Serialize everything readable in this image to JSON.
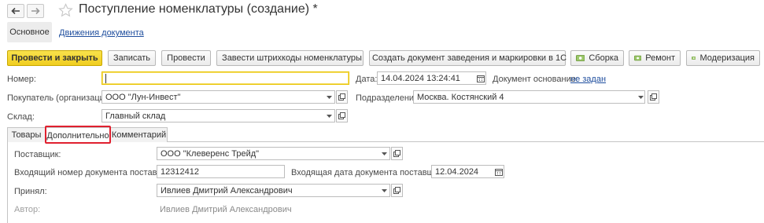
{
  "window": {
    "title": "Поступление номенклатуры (создание) *"
  },
  "top_tabs": {
    "main": "Основное",
    "movements": "Движения документа"
  },
  "toolbar": {
    "post_close": "Провести и закрыть",
    "save": "Записать",
    "post": "Провести",
    "barcodes": "Завести штрихкоды номенклатуры",
    "create_marking": "Создать документ заведения и маркировки в 1С",
    "assembly": "Сборка",
    "repair": "Ремонт",
    "modernization": "Модеризация"
  },
  "form": {
    "number_label": "Номер:",
    "number_value": "",
    "date_label": "Дата:",
    "date_value": "14.04.2024 13:24:41",
    "basis_label": "Документ основание:",
    "basis_value": "не задан",
    "buyer_label": "Покупатель (организация):",
    "buyer_value": "ООО \"Лун-Инвест\"",
    "division_label": "Подразделение:",
    "division_value": "Москва. Костянский 4",
    "warehouse_label": "Склад:",
    "warehouse_value": "Главный склад"
  },
  "inner_tabs": [
    "Товары",
    "Дополнительно",
    "Комментарий"
  ],
  "extra": {
    "supplier_label": "Поставщик:",
    "supplier_value": "ООО \"Клеверенс Трейд\"",
    "in_number_label": "Входящий номер документа поставщика:",
    "in_number_value": "12312412",
    "in_date_label": "Входящая дата документа поставщика:",
    "in_date_value": "12.04.2024",
    "accepted_label": "Принял:",
    "accepted_value": "Ивлиев Дмитрий Александрович",
    "author_label": "Автор:",
    "author_value": "Ивлиев Дмитрий Александрович"
  },
  "colors": {
    "primary_button": "#f5d631",
    "link": "#1f4e9e",
    "highlight_box": "#e0202f"
  }
}
